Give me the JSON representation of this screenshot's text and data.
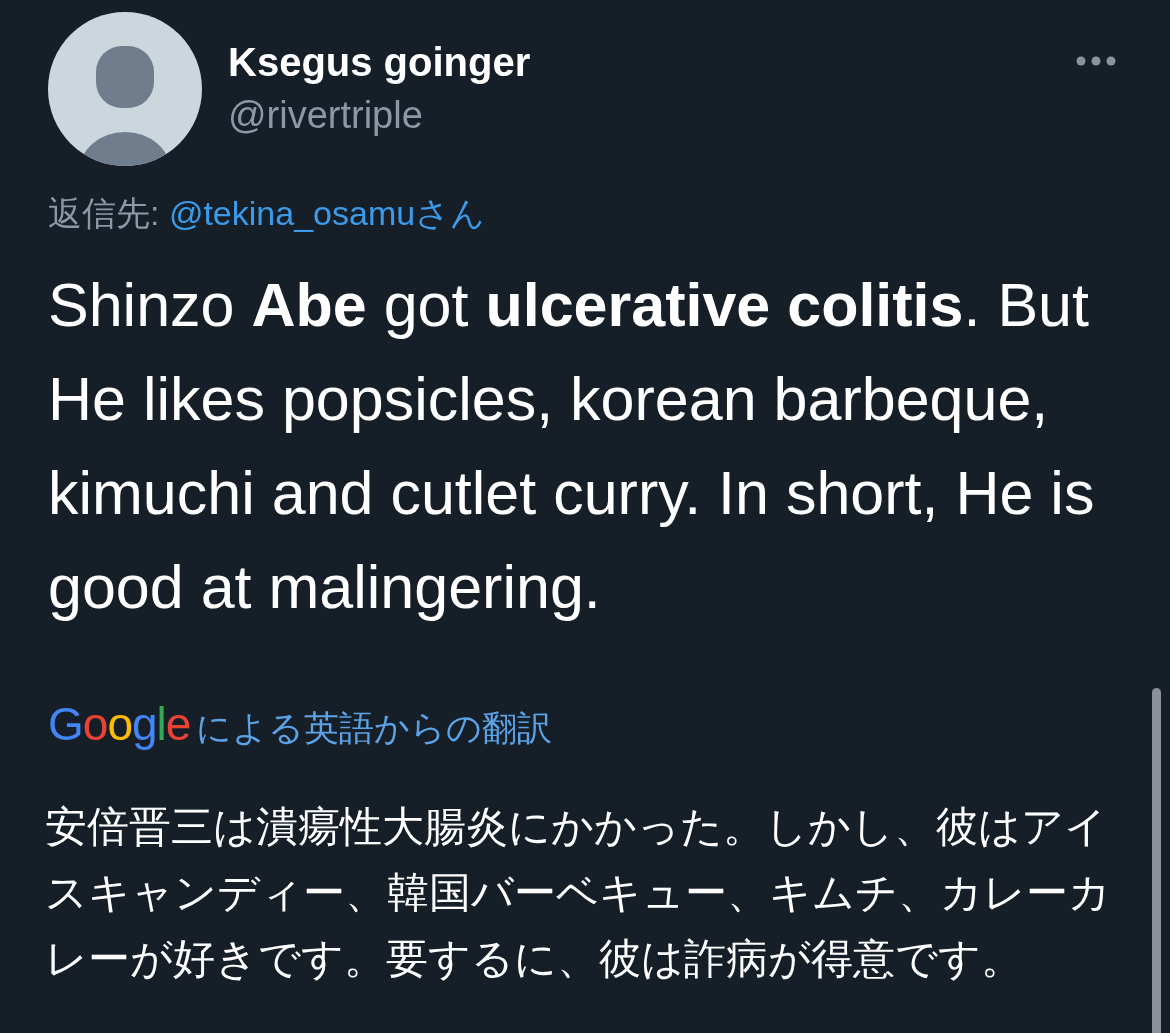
{
  "author": {
    "name": "Ksegus goinger",
    "handle": "@rivertriple"
  },
  "reply_to": {
    "label": "返信先:",
    "mention": "@tekina_osamuさん"
  },
  "tweet_text": "Shinzo **Abe** got **ulcerative colitis**. But He likes popsicles, korean barbeque, kimuchi and cutlet curry. In short, He is good at malingering.",
  "translation": {
    "provider": "Google",
    "label": "による英語からの翻訳",
    "text": "安倍晋三は潰瘍性大腸炎にかかった。しかし、彼はアイスキャンディー、韓国バーベキュー、キムチ、カレーカレーが好きです。要するに、彼は詐病が得意です。"
  }
}
